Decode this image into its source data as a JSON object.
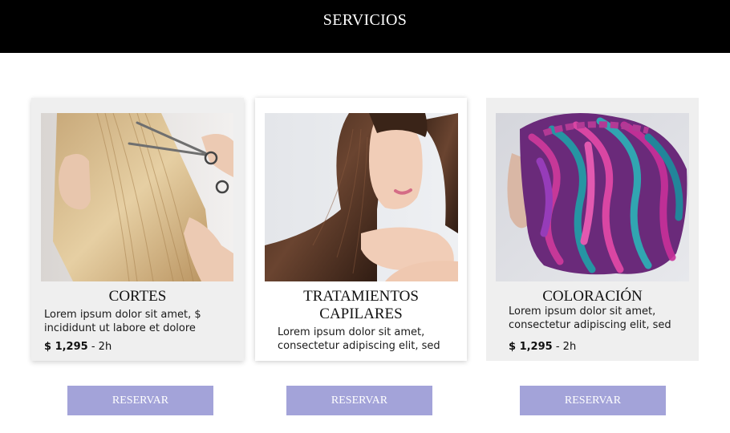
{
  "header": {
    "title": "SERVICIOS"
  },
  "services": [
    {
      "title": "CORTES",
      "description_line1": "Lorem ipsum dolor sit amet, $",
      "description_line2": "incididunt ut labore et dolore",
      "price": "$ 1,295",
      "separator": " - ",
      "duration": "2h",
      "image": "woman-cutting-blonde-hair-photo",
      "button_label": "RESERVAR"
    },
    {
      "title_line1": "TRATAMIENTOS",
      "title_line2": "CAPILARES",
      "description_line1": "Lorem ipsum dolor sit amet,",
      "description_line2": "consectetur adipiscing elit, sed",
      "image": "woman-brunette-long-hair-photo",
      "button_label": "RESERVAR"
    },
    {
      "title": "COLORACIÓN",
      "description_line1": "Lorem ipsum dolor sit amet,",
      "description_line2": "consectetur adipiscing elit, sed",
      "price": "$ 1,295",
      "separator": " - ",
      "duration": "2h",
      "image": "woman-pink-teal-colored-hair-photo",
      "button_label": "RESERVAR"
    }
  ],
  "colors": {
    "header_bg": "#000000",
    "card_bg": "#efefef",
    "button_bg": "#a3a3d9",
    "button_text": "#ffffff"
  }
}
